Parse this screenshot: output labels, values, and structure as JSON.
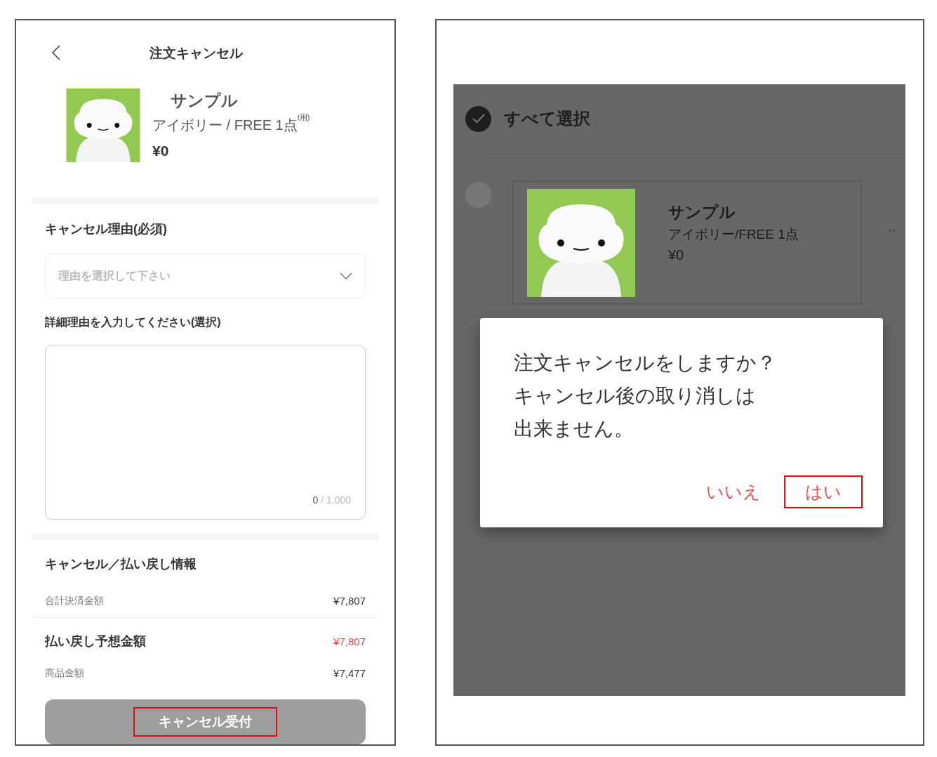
{
  "order_cancel_screen": {
    "title": "注文キャンセル",
    "product": {
      "name": "サンプル",
      "variant": "アイボリー / FREE 1点",
      "note_fragment": "t用)",
      "price": "¥0"
    },
    "reason": {
      "label": "キャンセル理由(必須)",
      "placeholder": "理由を選択して下さい"
    },
    "detail": {
      "label": "詳細理由を入力してください(選択)",
      "counter_current": "0",
      "counter_max": "/ 1,000"
    },
    "refund_info": {
      "title": "キャンセル／払い戻し情報",
      "rows": [
        {
          "kind": "plain",
          "label": "合計決済金額",
          "value": "¥7,807"
        },
        {
          "kind": "heading",
          "label": "払い戻し予想金額",
          "value": "¥7,807"
        },
        {
          "kind": "plain",
          "label": "商品金額",
          "value": "¥7,477"
        }
      ]
    },
    "submit_button": {
      "label": "キャンセル受付",
      "disabled": true,
      "highlighted": true
    }
  },
  "confirm_screen": {
    "select_all": {
      "label": "すべて選択",
      "checked": true
    },
    "items": [
      {
        "name": "サンプル",
        "variant": "アイボリー/FREE 1点",
        "price": "¥0",
        "checked": false
      }
    ],
    "dialog": {
      "lines": [
        "注文キャンセルをしますか？",
        "キャンセル後の取り消しは",
        "出来ません。"
      ],
      "buttons": [
        {
          "label": "いいえ",
          "highlighted": false
        },
        {
          "label": "はい",
          "highlighted": true
        }
      ]
    }
  }
}
